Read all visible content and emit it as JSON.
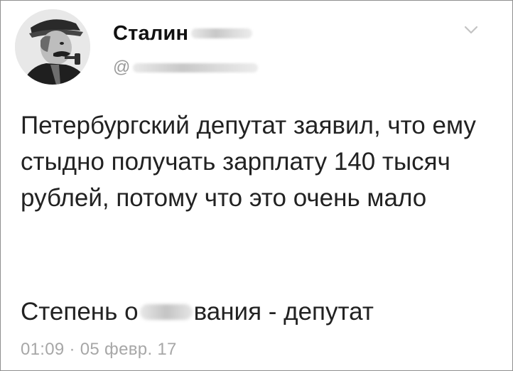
{
  "author": {
    "display_name_visible": "Сталин",
    "handle_visible": "@"
  },
  "tweet": {
    "text": "Петербургский депутат заявил, что ему стыдно получать зарплату 140 тысяч рублей, потому что это очень мало",
    "line2_before": "Степень о",
    "line2_after": "вания - депутат"
  },
  "meta": {
    "timestamp": "01:09 · 05 февр. 17"
  },
  "icons": {
    "menu": "chevron-down-icon",
    "avatar": "avatar"
  }
}
